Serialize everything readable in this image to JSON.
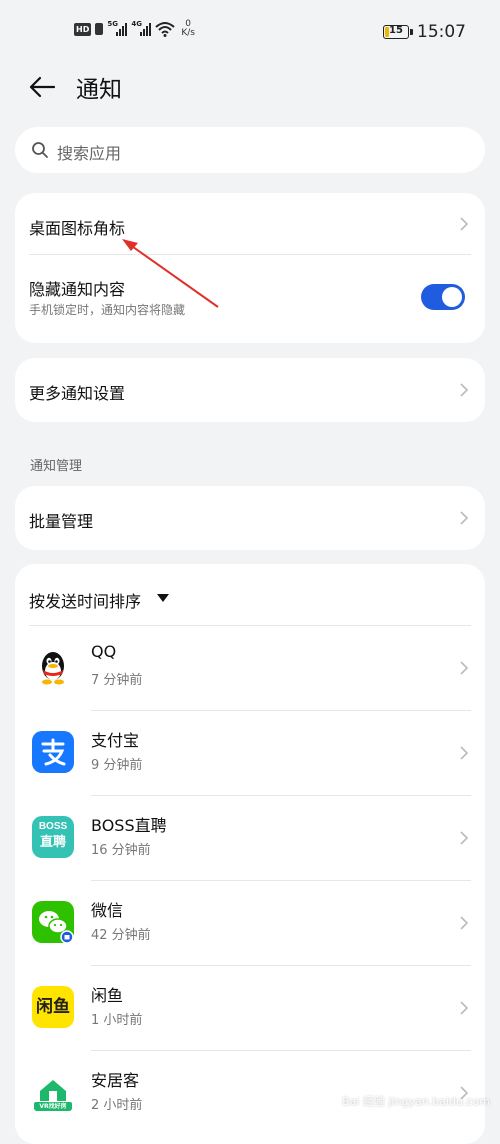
{
  "status_bar": {
    "hd": "HD",
    "sig1": "5G",
    "sig2": "4G",
    "speed_value": "0",
    "speed_unit": "K/s",
    "battery": "15",
    "time": "15:07"
  },
  "header": {
    "title": "通知"
  },
  "search": {
    "placeholder": "搜索应用"
  },
  "settings": {
    "badge_label": "桌面图标角标",
    "hide_label": "隐藏通知内容",
    "hide_sub": "手机锁定时，通知内容将隐藏",
    "hide_enabled": true,
    "more_label": "更多通知设置"
  },
  "management": {
    "section_label": "通知管理",
    "batch_label": "批量管理"
  },
  "apps": {
    "sort_label": "按发送时间排序",
    "list": [
      {
        "name": "QQ",
        "time": "7 分钟前",
        "icon": "qq-icon"
      },
      {
        "name": "支付宝",
        "time": "9 分钟前",
        "icon": "alipay-icon"
      },
      {
        "name": "BOSS直聘",
        "time": "16 分钟前",
        "icon": "boss-icon"
      },
      {
        "name": "微信",
        "time": "42 分钟前",
        "icon": "wechat-icon"
      },
      {
        "name": "闲鱼",
        "time": "1 小时前",
        "icon": "xianyu-icon"
      },
      {
        "name": "安居客",
        "time": "2 小时前",
        "icon": "anjuke-icon"
      }
    ],
    "boss_icon_text_top": "BOSS",
    "boss_icon_text_bottom": "直聘",
    "xianyu_icon_text": "闲鱼",
    "anjuke_icon_text": "VR找好房"
  },
  "colors": {
    "accent": "#1f5cdf",
    "background": "#f1f3f5",
    "annotation_arrow": "#e0302a"
  },
  "watermark": "Bai 经验 jingyan.baidu.com"
}
